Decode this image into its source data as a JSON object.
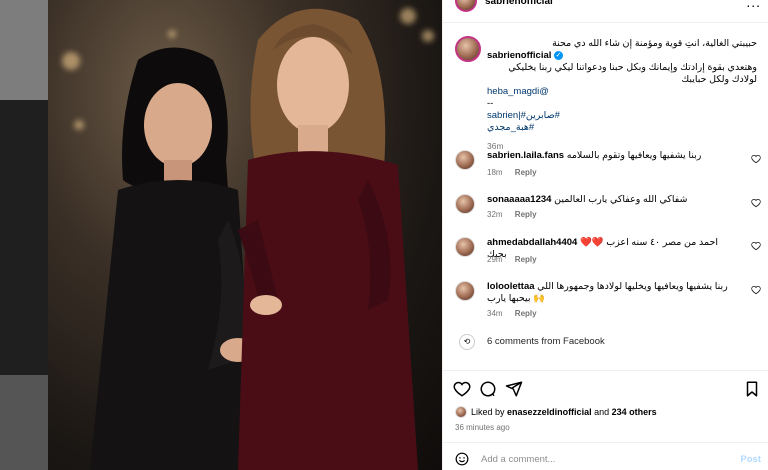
{
  "header": {
    "username": "sabrienofficial",
    "more": "..."
  },
  "caption": {
    "first_line": "حبيبتي الغالية، انتِ قوية ومؤمنة إن شاء الله دي محنة",
    "username": "sabrienofficial",
    "verified_glyph": "✓",
    "body": "وهتعدي بقوة إرادتك وإيمانك وبكل حبنا ودعواتنا ليكي ربنا يخليكي لولادك ولكل حبايبك",
    "mention": "heba_magdi@",
    "separator": "--",
    "hashtags": "sabrien|#صابرين#",
    "hashtag2": "هبة_مجدي#",
    "time": "36m"
  },
  "comments": [
    {
      "username": "sabrien.laila.fans",
      "text": "ربنا يشفيها ويعافيها وتقوم بالسلامه",
      "time": "18m",
      "reply": "Reply"
    },
    {
      "username": "sonaaaaa1234",
      "text": "شفاكي الله وعفاكي يارب العالمين",
      "time": "32m",
      "reply": "Reply"
    },
    {
      "username": "ahmedabdallah4404",
      "text": "❤️❤️ احمد من مصر ٤٠ سنه اعزب بحبك",
      "time": "29m",
      "reply": "Reply"
    },
    {
      "username": "loloolettaa",
      "text": "ربنا يشفيها ويعافيها ويخليها لولادها وجمهورها اللي بيحبها يارب 🙌",
      "time": "34m",
      "reply": "Reply"
    }
  ],
  "facebook": {
    "label": "6 comments from Facebook",
    "glyph": "⟲"
  },
  "likes": {
    "prefix": "Liked by",
    "user": "enasezzeldinofficial",
    "middle": "and",
    "count": "234 others"
  },
  "time_ago": "36 minutes ago",
  "add_comment": {
    "placeholder": "Add a comment...",
    "post": "Post"
  },
  "colors": {
    "accent": "#0095f6",
    "ring": "#c13584",
    "heart": "#ed4956",
    "post_disabled": "#b3dbff"
  }
}
